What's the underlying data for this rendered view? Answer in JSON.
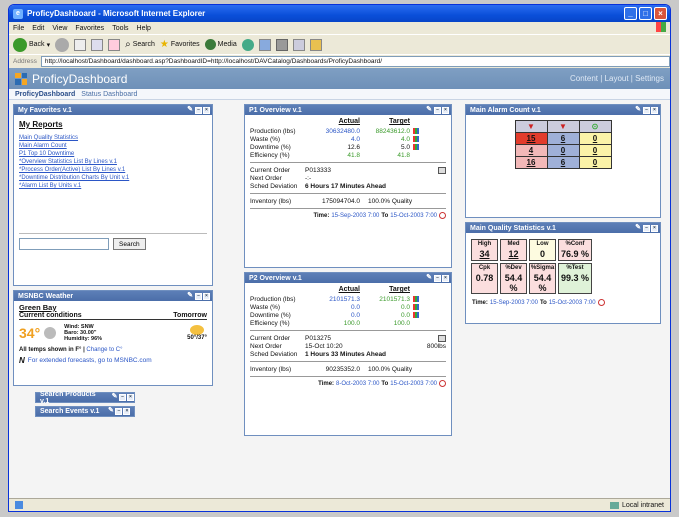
{
  "window": {
    "title": "ProficyDashboard - Microsoft Internet Explorer"
  },
  "menu": [
    "File",
    "Edit",
    "View",
    "Favorites",
    "Tools",
    "Help"
  ],
  "toolbar": {
    "back": "Back",
    "search": "Search",
    "favorites": "Favorites",
    "media": "Media"
  },
  "address": {
    "label": "Address",
    "url": "http://localhost/Dashboard/dashboard.asp?DashboardID=http://localhost/DAVCatalog/Dashboards/ProficyDashboard/"
  },
  "app": {
    "title": "ProficyDashboard",
    "links": "Content | Layout | Settings"
  },
  "subnav": {
    "active": "ProficyDashboard",
    "other": "Status Dashboard"
  },
  "favorites": {
    "title": "My Favorites v.1",
    "heading": "My Reports",
    "links": [
      "Main Quality Statistics",
      "Main Alarm Count",
      "P1 Top 10 Downtime",
      "*Overview Statistics List By Lines v.1",
      "*Process Order(Active) List By Lines v.1",
      "*Downtime Distribution Charts By Unit v.1",
      "*Alarm List By Units v.1"
    ],
    "search_button": "Search"
  },
  "weather": {
    "title": "MSNBC Weather",
    "city": "Green Bay",
    "current": "Current conditions",
    "tomorrow": "Tomorrow",
    "temp": "34°",
    "wind": "Wind: SNW",
    "baro": "Baro: 30.00\"",
    "humidity": "Humidity: 96%",
    "forecast": "50°/37°",
    "temps_note": "All temps shown in F°",
    "change": "Change to C°",
    "msnbc_note": "For extended forecasts, go to MSNBC.com"
  },
  "search_products": "Search Products v.1",
  "search_events": "Search Events v.1",
  "p1": {
    "title": "P1 Overview v.1",
    "col_actual": "Actual",
    "col_target": "Target",
    "rows": [
      {
        "k": "Production (lbs)",
        "a": "30632480.0",
        "t": "88243612.0"
      },
      {
        "k": "Waste (%)",
        "a": "4.0",
        "t": "4.0"
      },
      {
        "k": "Downtime (%)",
        "a": "12.6",
        "t": "5.0"
      },
      {
        "k": "Efficiency (%)",
        "a": "41.8",
        "t": "41.8"
      }
    ],
    "current_order_label": "Current Order",
    "current_order": "P013333",
    "next_order_label": "Next Order",
    "next_order": "-:-",
    "sched_label": "Sched Deviation",
    "sched": "6 Hours 17 Minutes Ahead",
    "inventory_label": "Inventory (lbs)",
    "inventory": "175094704.0",
    "quality": "100.0% Quality",
    "time_label": "Time:",
    "time_from": "15-Sep-2003 7:00",
    "to": "To",
    "time_to": "15-Oct-2003 7:00"
  },
  "p2": {
    "title": "P2 Overview v.1",
    "col_actual": "Actual",
    "col_target": "Target",
    "rows": [
      {
        "k": "Production (lbs)",
        "a": "2101571.3",
        "t": "2101571.3"
      },
      {
        "k": "Waste (%)",
        "a": "0.0",
        "t": "0.0"
      },
      {
        "k": "Downtime (%)",
        "a": "0.0",
        "t": "0.0"
      },
      {
        "k": "Efficiency (%)",
        "a": "100.0",
        "t": "100.0"
      }
    ],
    "current_order_label": "Current Order",
    "current_order": "P013275",
    "next_order_label": "Next Order",
    "next_order": "15-Oct 10:20",
    "next_extra": "800lbs",
    "sched_label": "Sched Deviation",
    "sched": "1 Hours 33 Minutes Ahead",
    "inventory_label": "Inventory (lbs)",
    "inventory": "90235352.0",
    "quality": "100.0% Quality",
    "time_label": "Time:",
    "time_from": "8-Oct-2003 7:00",
    "to": "To",
    "time_to": "15-Oct-2003 7:00"
  },
  "alarm": {
    "title": "Main Alarm Count v.1",
    "headers": [
      "▼",
      "▼",
      "⊙"
    ],
    "rows": [
      [
        "15",
        "6",
        "0"
      ],
      [
        "4",
        "0",
        "0"
      ],
      [
        "16",
        "6",
        "0"
      ]
    ],
    "colors": [
      "#e23c2c",
      "#f2b8b8",
      "#fbf3a8"
    ]
  },
  "quality": {
    "title": "Main Quality Statistics v.1",
    "cells": [
      {
        "label": "High",
        "val": "34",
        "u": true
      },
      {
        "label": "Med",
        "val": "12",
        "u": true
      },
      {
        "label": "Low",
        "val": "0",
        "u": false
      },
      {
        "label": "%Conf",
        "val": "76.9 %",
        "u": false
      },
      {
        "label": "Cpk",
        "val": "0.78",
        "u": false
      },
      {
        "label": "%Dev",
        "val": "54.4 %",
        "u": false
      },
      {
        "label": "%Sigma",
        "val": "54.4 %",
        "u": false
      },
      {
        "label": "%Test",
        "val": "99.3 %",
        "u": false
      }
    ],
    "time_label": "Time:",
    "time_from": "15-Sep-2003 7:00",
    "to": "To",
    "time_to": "15-Oct-2003 7:00"
  },
  "status": {
    "local": "Local intranet"
  }
}
